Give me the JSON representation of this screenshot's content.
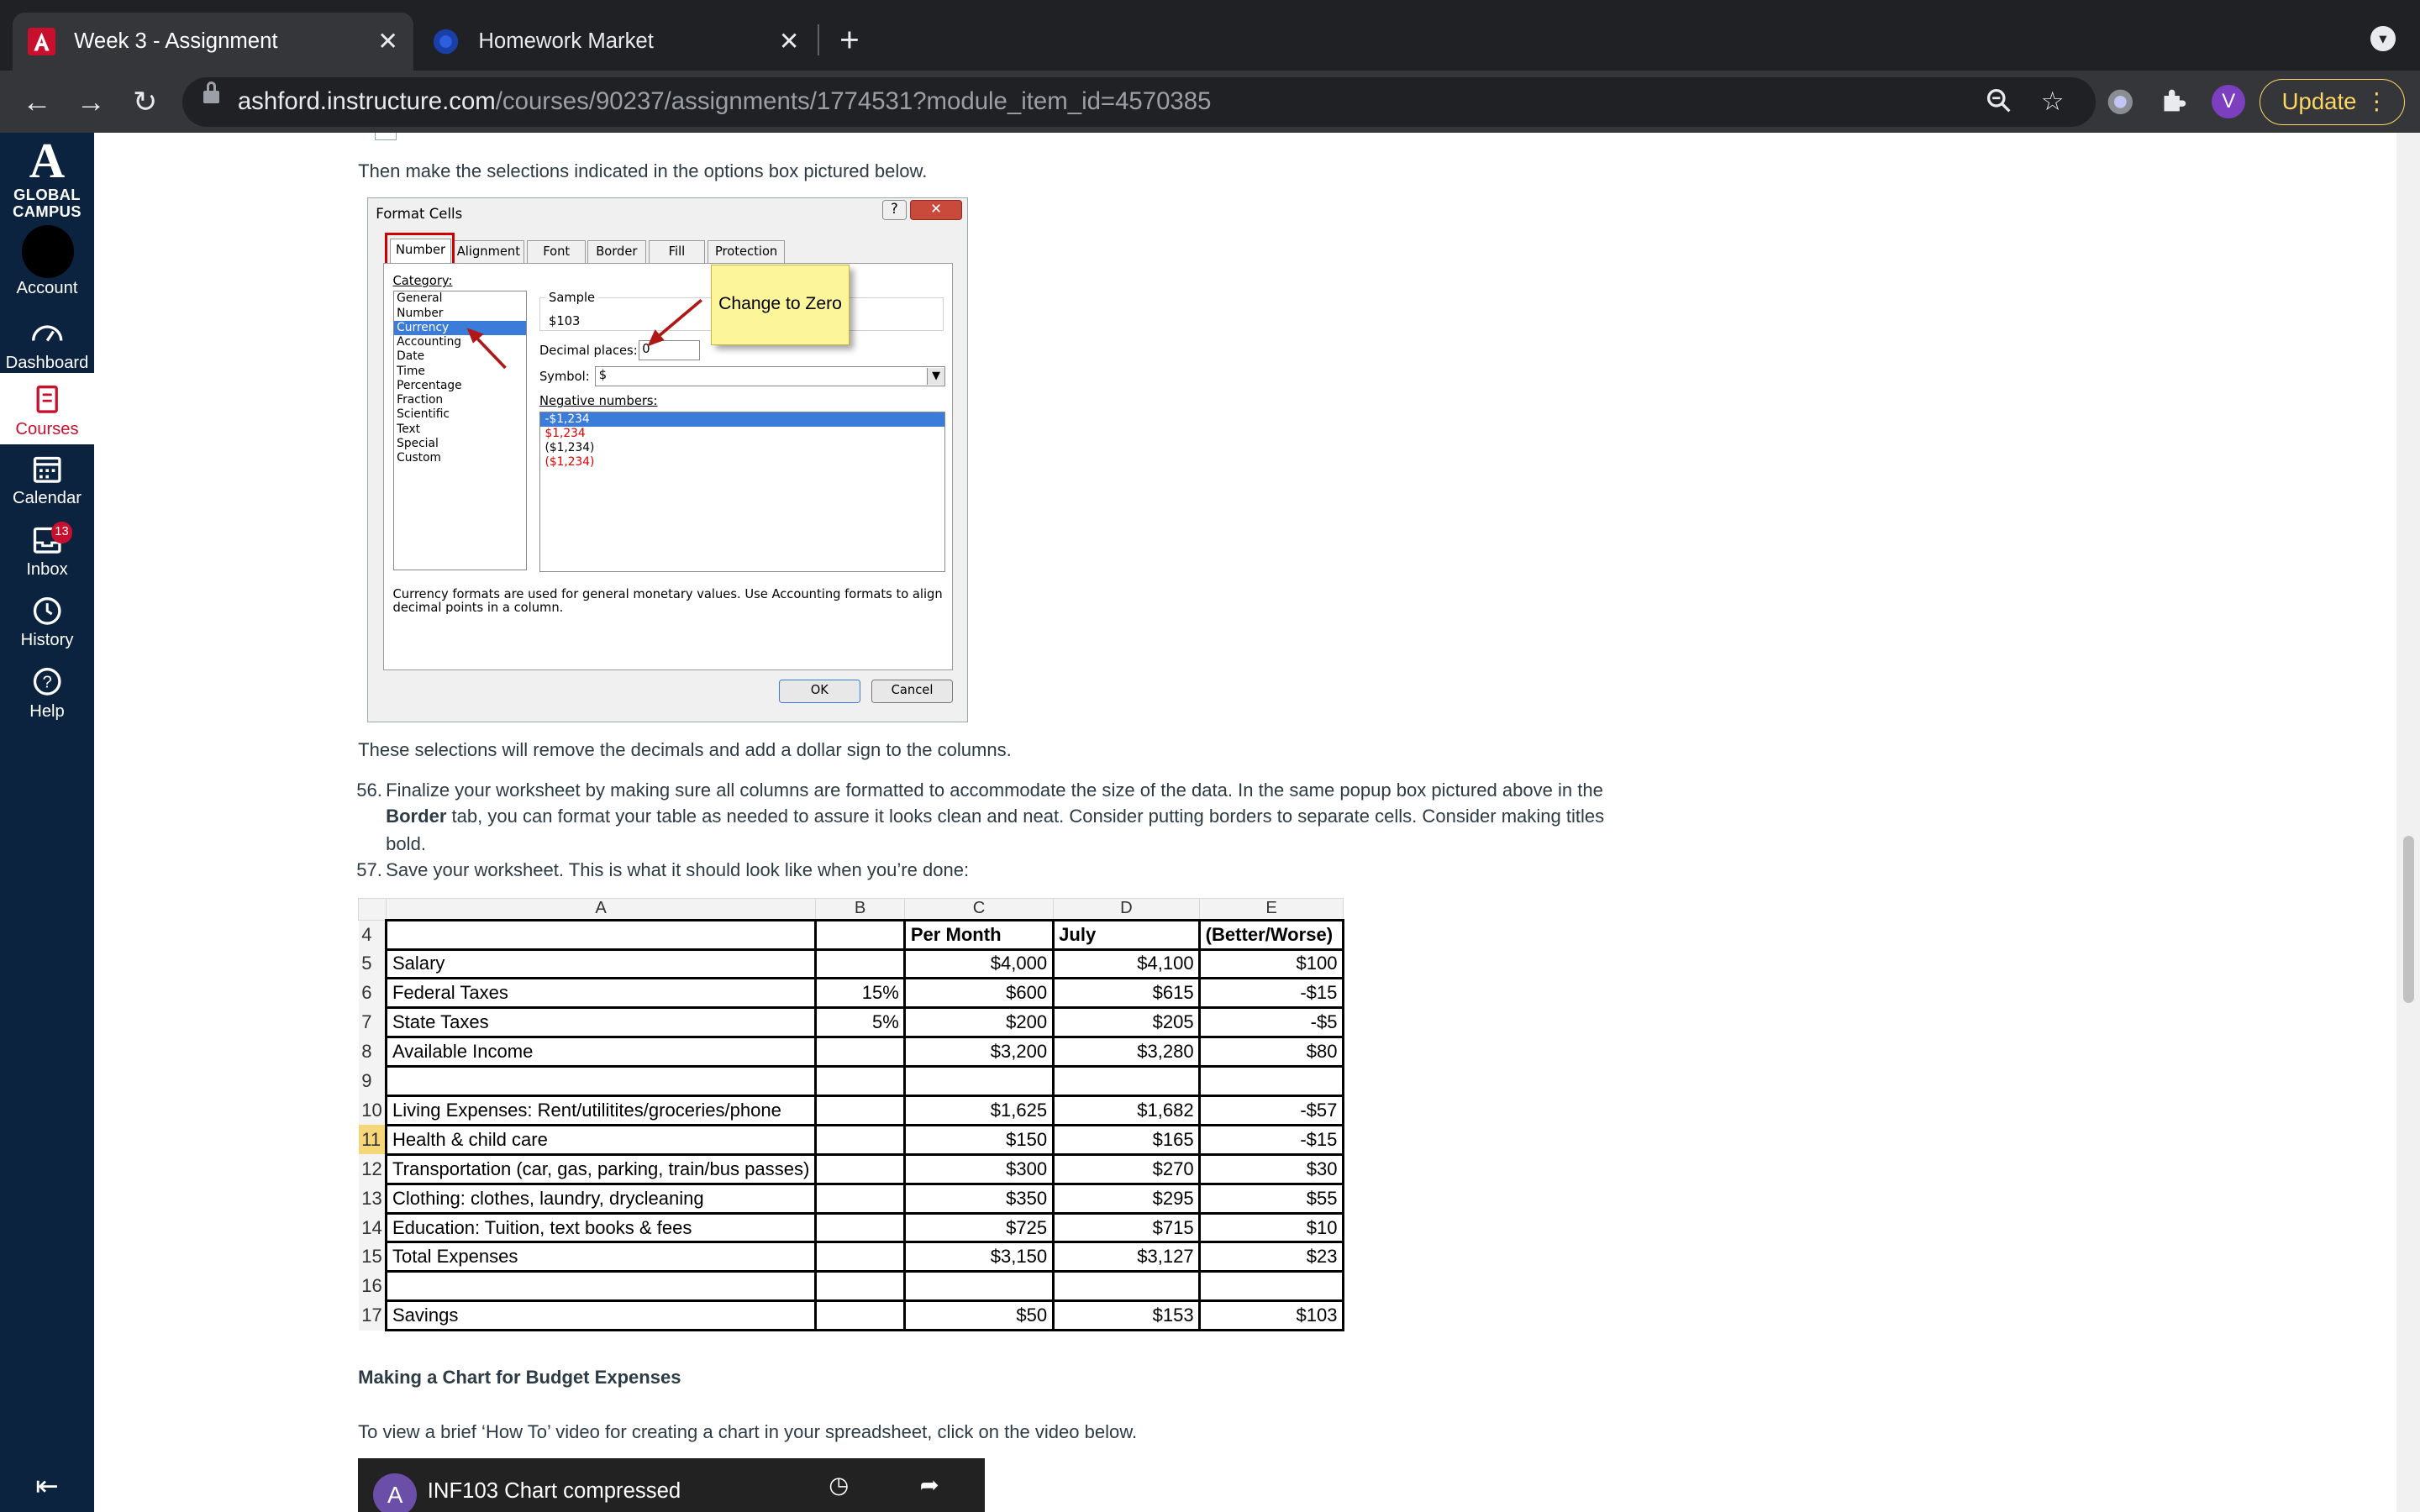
{
  "browser": {
    "tabs": [
      {
        "title": "Week 3 - Assignment",
        "active": true
      },
      {
        "title": "Homework Market",
        "active": false
      }
    ],
    "url_host": "ashford.instructure.com",
    "url_path": "/courses/90237/assignments/1774531?module_item_id=4570385",
    "avatar_letter": "V",
    "update_label": "Update"
  },
  "nav": {
    "logo_glyph": "A",
    "logo_line1": "GLOBAL",
    "logo_line2": "CAMPUS",
    "items": [
      {
        "label": "Account"
      },
      {
        "label": "Dashboard"
      },
      {
        "label": "Courses"
      },
      {
        "label": "Calendar"
      },
      {
        "label": "Inbox",
        "badge": "13"
      },
      {
        "label": "History"
      },
      {
        "label": "Help"
      }
    ]
  },
  "content": {
    "intro": "Then make the selections indicated in the options box pictured below.",
    "after_dialog": "These selections will remove the decimals and add a dollar sign to the columns.",
    "step56_num": "56.",
    "step56_line1": "Finalize your worksheet by making sure all columns are formatted to accommodate the size of the data.  In the same popup box pictured above in the",
    "step56_bold": "Border",
    "step56_line2": " tab, you can format your table as needed to assure it looks clean and neat.  Consider putting borders to separate cells.  Consider making titles",
    "step56_line3": "bold.",
    "step57_num": "57.",
    "step57": "Save your worksheet. This is what it should look like when you’re done:",
    "chart_heading": "Making a Chart for Budget Expenses",
    "video_intro": "To view a brief ‘How To’ video for creating a chart in your spreadsheet, click on the video below.",
    "video_avatar": "A",
    "video_title": "INF103 Chart compressed"
  },
  "dialog": {
    "title": "Format Cells",
    "help": "?",
    "close": "✕",
    "tabs": [
      "Number",
      "Alignment",
      "Font",
      "Border",
      "Fill",
      "Protection"
    ],
    "category_label": "Category:",
    "categories": [
      "General",
      "Number",
      "Currency",
      "Accounting",
      "Date",
      "Time",
      "Percentage",
      "Fraction",
      "Scientific",
      "Text",
      "Special",
      "Custom"
    ],
    "selected_category": "Currency",
    "sample_label": "Sample",
    "sample_value": "$103",
    "decimal_label": "Decimal places:",
    "decimal_value": "0",
    "symbol_label": "Symbol:",
    "symbol_value": "$",
    "negative_label": "Negative numbers:",
    "negatives": [
      "-$1,234",
      "$1,234",
      "($1,234)",
      "($1,234)"
    ],
    "description": "Currency formats are used for general monetary values.  Use Accounting formats to align",
    "description2": "decimal points in a column.",
    "ok": "OK",
    "cancel": "Cancel",
    "callout": "Change to Zero"
  },
  "sheet": {
    "columns": [
      "A",
      "B",
      "C",
      "D",
      "E"
    ],
    "rows": [
      {
        "n": "4",
        "a": "",
        "b": "",
        "c": "Per Month",
        "d": "July",
        "e": "(Better/Worse)",
        "header": true
      },
      {
        "n": "5",
        "a": "Salary",
        "b": "",
        "c": "$4,000",
        "d": "$4,100",
        "e": "$100"
      },
      {
        "n": "6",
        "a": "Federal Taxes",
        "b": "15%",
        "c": "$600",
        "d": "$615",
        "e": "-$15"
      },
      {
        "n": "7",
        "a": "State Taxes",
        "b": "5%",
        "c": "$200",
        "d": "$205",
        "e": "-$5"
      },
      {
        "n": "8",
        "a": "Available Income",
        "b": "",
        "c": "$3,200",
        "d": "$3,280",
        "e": "$80"
      },
      {
        "n": "9",
        "a": "",
        "b": "",
        "c": "",
        "d": "",
        "e": ""
      },
      {
        "n": "10",
        "a": "Living Expenses: Rent/utilitites/groceries/phone",
        "b": "",
        "c": "$1,625",
        "d": "$1,682",
        "e": "-$57"
      },
      {
        "n": "11",
        "a": "Health & child care",
        "b": "",
        "c": "$150",
        "d": "$165",
        "e": "-$15",
        "selected": true
      },
      {
        "n": "12",
        "a": "Transportation (car, gas, parking, train/bus passes)",
        "b": "",
        "c": "$300",
        "d": "$270",
        "e": "$30"
      },
      {
        "n": "13",
        "a": "Clothing: clothes, laundry, drycleaning",
        "b": "",
        "c": "$350",
        "d": "$295",
        "e": "$55"
      },
      {
        "n": "14",
        "a": "Education: Tuition, text books & fees",
        "b": "",
        "c": "$725",
        "d": "$715",
        "e": "$10"
      },
      {
        "n": "15",
        "a": "Total Expenses",
        "b": "",
        "c": "$3,150",
        "d": "$3,127",
        "e": "$23"
      },
      {
        "n": "16",
        "a": "",
        "b": "",
        "c": "",
        "d": "",
        "e": ""
      },
      {
        "n": "17",
        "a": "Savings",
        "b": "",
        "c": "$50",
        "d": "$153",
        "e": "$103"
      }
    ]
  },
  "colors": {
    "nav_bg": "#0c2340",
    "nav_active_text": "#c8102e",
    "chrome_bg": "#202124",
    "toolbar_bg": "#35363a"
  }
}
